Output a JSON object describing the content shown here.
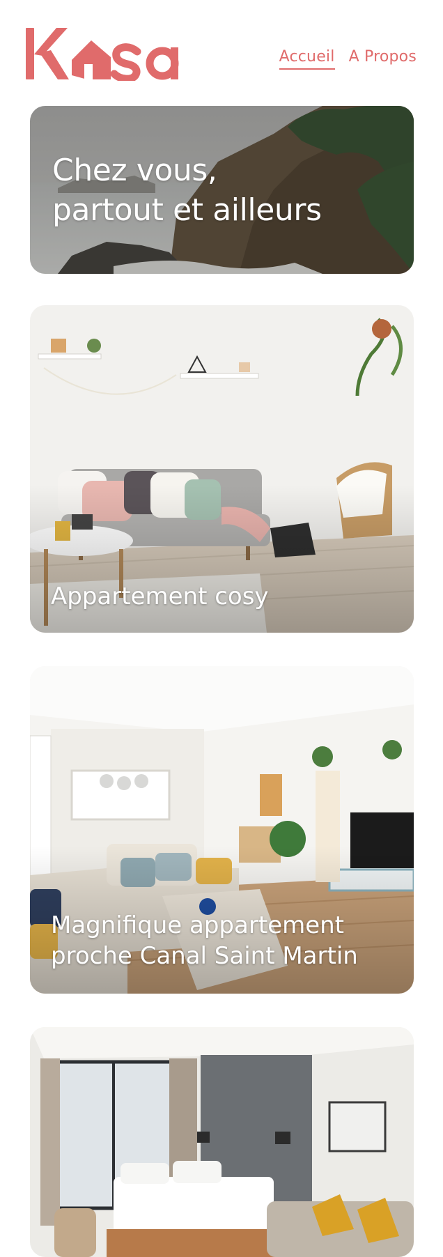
{
  "brand": {
    "name": "Kasa",
    "color": "#E06B6B"
  },
  "nav": {
    "items": [
      {
        "label": "Accueil",
        "active": true
      },
      {
        "label": "A Propos",
        "active": false
      }
    ]
  },
  "banner": {
    "line1": "Chez vous,",
    "line2": "partout et ailleurs"
  },
  "listings": [
    {
      "title": "Appartement cosy"
    },
    {
      "title": "Magnifique appartement proche Canal Saint Martin"
    },
    {
      "title": ""
    }
  ]
}
